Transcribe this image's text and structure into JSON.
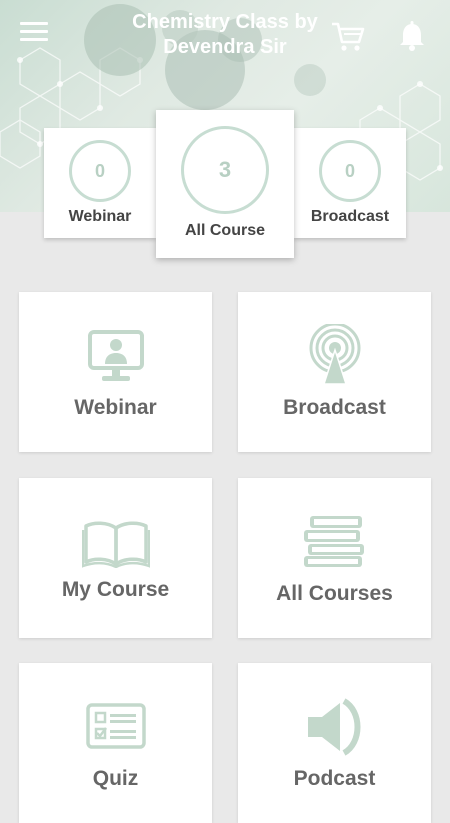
{
  "header": {
    "title_line1": "Chemistry Class by",
    "title_line2": "Devendra Sir"
  },
  "stats": [
    {
      "count": "0",
      "label": "Webinar"
    },
    {
      "count": "3",
      "label": "All Course"
    },
    {
      "count": "0",
      "label": "Broadcast"
    }
  ],
  "tiles": [
    {
      "label": "Webinar",
      "icon": "webinar-icon"
    },
    {
      "label": "Broadcast",
      "icon": "broadcast-icon"
    },
    {
      "label": "My Course",
      "icon": "open-book-icon"
    },
    {
      "label": "All Courses",
      "icon": "books-stack-icon"
    },
    {
      "label": "Quiz",
      "icon": "quiz-icon"
    },
    {
      "label": "Podcast",
      "icon": "speaker-icon"
    }
  ],
  "colors": {
    "accent": "#c7ddd2",
    "icon": "#c3d8cb",
    "label": "#666666"
  }
}
